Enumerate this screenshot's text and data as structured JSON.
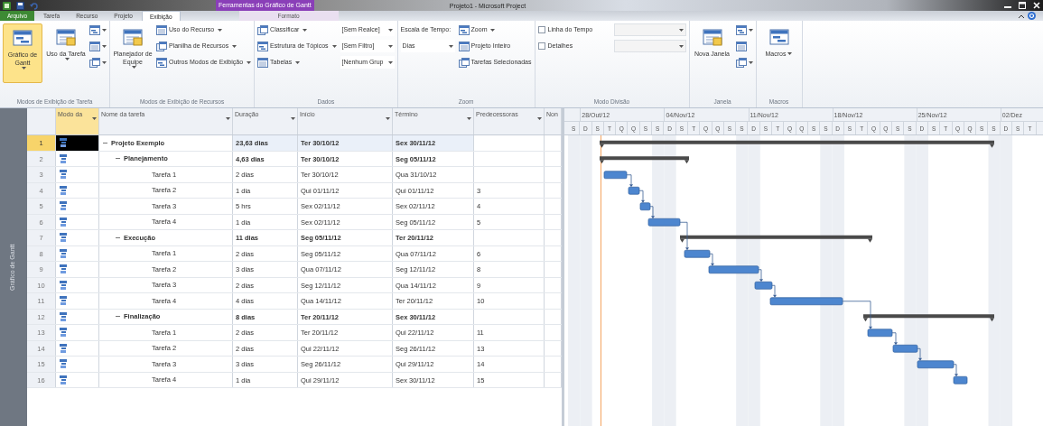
{
  "window": {
    "title": "Projeto1 - Microsoft Project",
    "context_tab": "Ferramentas do Gráfico de Gantt"
  },
  "tabs": [
    {
      "label": "Arquivo",
      "kind": "file",
      "selected": false
    },
    {
      "label": "Tarefa",
      "kind": "tab",
      "selected": false
    },
    {
      "label": "Recurso",
      "kind": "tab",
      "selected": false
    },
    {
      "label": "Projeto",
      "kind": "tab",
      "selected": false
    },
    {
      "label": "Exibição",
      "kind": "tab",
      "selected": true
    },
    {
      "label": "Formato",
      "kind": "context",
      "selected": false
    }
  ],
  "ribbon": {
    "groups": [
      {
        "label": "Modos de Exibição de Tarefa",
        "columns": [
          {
            "items": [
              {
                "kind": "large",
                "text": "Gráfico de Gantt",
                "caret": true,
                "selected": true
              }
            ]
          },
          {
            "items": [
              {
                "kind": "large",
                "text": "Uso da Tarefa",
                "caret": true,
                "selected": false
              }
            ]
          },
          {
            "items": [
              {
                "kind": "icon",
                "caret": true
              },
              {
                "kind": "icon",
                "caret": true
              },
              {
                "kind": "icon",
                "caret": true
              }
            ]
          }
        ]
      },
      {
        "label": "Modos de Exibição de Recursos",
        "columns": [
          {
            "items": [
              {
                "kind": "large",
                "text": "Planejador de Equipe",
                "caret": true,
                "selected": false
              }
            ]
          },
          {
            "items": [
              {
                "kind": "small",
                "text": "Uso do Recurso",
                "caret": true
              },
              {
                "kind": "small",
                "text": "Planilha de Recursos",
                "caret": true
              },
              {
                "kind": "small",
                "text": "Outros Modos de Exibição",
                "caret": true
              }
            ]
          }
        ]
      },
      {
        "label": "Dados",
        "columns": [
          {
            "items": [
              {
                "kind": "small",
                "text": "Classificar",
                "caret": true
              },
              {
                "kind": "small",
                "text": "Estrutura de Tópicos",
                "caret": true
              },
              {
                "kind": "small",
                "text": "Tabelas",
                "caret": true
              }
            ]
          },
          {
            "items": [
              {
                "kind": "combo",
                "text": "[Sem Realce]"
              },
              {
                "kind": "combo",
                "text": "[Sem Filtro]"
              },
              {
                "kind": "combo",
                "text": "[Nenhum Grup"
              }
            ]
          }
        ]
      },
      {
        "label": "Zoom",
        "columns": [
          {
            "items": [
              {
                "kind": "label",
                "text": "Escala de Tempo:"
              },
              {
                "kind": "combo",
                "text": "Dias"
              }
            ]
          },
          {
            "items": [
              {
                "kind": "small",
                "text": "Zoom",
                "caret": true
              },
              {
                "kind": "small",
                "text": "Projeto Inteiro",
                "caret": false
              },
              {
                "kind": "small",
                "text": "Tarefas Selecionadas",
                "caret": false
              }
            ]
          }
        ]
      },
      {
        "label": "Modo Divisão",
        "columns": [
          {
            "items": [
              {
                "kind": "checkbox",
                "text": "Linha do Tempo",
                "checked": false
              },
              {
                "kind": "checkbox",
                "text": "Detalhes",
                "checked": false
              }
            ]
          },
          {
            "items": [
              {
                "kind": "combo"
              },
              {
                "kind": "combo"
              }
            ]
          }
        ]
      },
      {
        "label": "Janela",
        "columns": [
          {
            "items": [
              {
                "kind": "large",
                "text": "Nova Janela",
                "caret": false,
                "selected": false
              }
            ]
          },
          {
            "items": [
              {
                "kind": "icon",
                "caret": true
              },
              {
                "kind": "icon",
                "caret": false
              },
              {
                "kind": "icon",
                "caret": true
              }
            ]
          }
        ]
      },
      {
        "label": "Macros",
        "columns": [
          {
            "items": [
              {
                "kind": "large",
                "text": "Macros",
                "caret": true,
                "selected": false
              }
            ]
          }
        ]
      }
    ]
  },
  "view_bar": {
    "label": "Gráfico de Gantt"
  },
  "table": {
    "columns": [
      "Modo da",
      "Nome da tarefa",
      "Duração",
      "Início",
      "Término",
      "Predecessoras",
      "Non"
    ],
    "tasks": [
      {
        "row": "1",
        "name": "Projeto Exemplo",
        "duration": "23,63 dias",
        "start": "Ter 30/10/12",
        "finish": "Sex 30/11/12",
        "selected": true,
        "expanded": true,
        "children": [
          {
            "row": "2",
            "name": "Planejamento",
            "duration": "4,63 dias",
            "start": "Ter 30/10/12",
            "finish": "Seg 05/11/12",
            "selected": false,
            "expanded": true,
            "children": [
              {
                "row": "3",
                "name": "Tarefa 1",
                "duration": "2 dias",
                "start": "Ter 30/10/12",
                "finish": "Qua 31/10/12",
                "selected": false
              },
              {
                "row": "4",
                "name": "Tarefa 2",
                "duration": "1 dia",
                "start": "Qui 01/11/12",
                "finish": "Qui 01/11/12",
                "predecessors": "3",
                "selected": false
              },
              {
                "row": "5",
                "name": "Tarefa 3",
                "duration": "5 hrs",
                "start": "Sex 02/11/12",
                "finish": "Sex 02/11/12",
                "predecessors": "4",
                "selected": false
              },
              {
                "row": "6",
                "name": "Tarefa 4",
                "duration": "1 dia",
                "start": "Sex 02/11/12",
                "finish": "Seg 05/11/12",
                "predecessors": "5",
                "selected": false
              }
            ]
          },
          {
            "row": "7",
            "name": "Execução",
            "duration": "11 dias",
            "start": "Seg 05/11/12",
            "finish": "Ter 20/11/12",
            "selected": false,
            "expanded": true,
            "children": [
              {
                "row": "8",
                "name": "Tarefa 1",
                "duration": "2 dias",
                "start": "Seg 05/11/12",
                "finish": "Qua 07/11/12",
                "predecessors": "6",
                "selected": false
              },
              {
                "row": "9",
                "name": "Tarefa 2",
                "duration": "3 dias",
                "start": "Qua 07/11/12",
                "finish": "Seg 12/11/12",
                "predecessors": "8",
                "selected": false
              },
              {
                "row": "10",
                "name": "Tarefa 3",
                "duration": "2 dias",
                "start": "Seg 12/11/12",
                "finish": "Qua 14/11/12",
                "predecessors": "9",
                "selected": false
              },
              {
                "row": "11",
                "name": "Tarefa 4",
                "duration": "4 dias",
                "start": "Qua 14/11/12",
                "finish": "Ter 20/11/12",
                "predecessors": "10",
                "selected": false
              }
            ]
          },
          {
            "row": "12",
            "name": "Finalização",
            "duration": "8 dias",
            "start": "Ter 20/11/12",
            "finish": "Sex 30/11/12",
            "selected": false,
            "expanded": true,
            "children": [
              {
                "row": "13",
                "name": "Tarefa 1",
                "duration": "2 dias",
                "start": "Ter 20/11/12",
                "finish": "Qui 22/11/12",
                "predecessors": "11",
                "selected": false
              },
              {
                "row": "14",
                "name": "Tarefa 2",
                "duration": "2 dias",
                "start": "Qui 22/11/12",
                "finish": "Seg 26/11/12",
                "predecessors": "13",
                "selected": false
              },
              {
                "row": "15",
                "name": "Tarefa 3",
                "duration": "3 dias",
                "start": "Seg 26/11/12",
                "finish": "Qui 29/11/12",
                "predecessors": "14",
                "selected": false
              },
              {
                "row": "16",
                "name": "Tarefa 4",
                "duration": "1 dia",
                "start": "Qui 29/11/12",
                "finish": "Sex 30/11/12",
                "predecessors": "15",
                "selected": false
              }
            ]
          }
        ]
      }
    ]
  },
  "timescale": {
    "weeks": [
      "28/Out/12",
      "04/Nov/12",
      "11/Nov/12",
      "18/Nov/12",
      "25/Nov/12",
      "02/Dez"
    ],
    "days": [
      "S",
      "D",
      "S",
      "T",
      "Q",
      "Q",
      "S",
      "S",
      "D",
      "S",
      "T",
      "Q",
      "Q",
      "S",
      "S",
      "D",
      "S",
      "T",
      "Q",
      "Q",
      "S",
      "S",
      "D",
      "S",
      "T",
      "Q",
      "Q",
      "S",
      "S",
      "D",
      "S",
      "T",
      "Q",
      "Q",
      "S",
      "S",
      "D",
      "S",
      "T"
    ]
  }
}
